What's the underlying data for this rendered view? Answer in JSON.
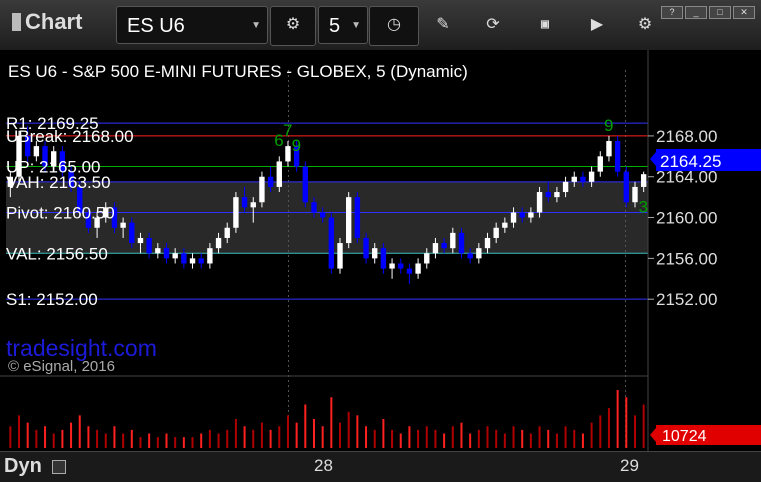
{
  "app": {
    "title": "Chart"
  },
  "toolbar": {
    "symbol": "ES U6",
    "interval": "5",
    "icons": [
      "settings-icon",
      "clock-icon",
      "pencil-icon",
      "refresh-icon",
      "quote-icon",
      "play-icon",
      "settings-wheel-icon"
    ]
  },
  "colors": {
    "background": "#000000",
    "up": "#ffffff",
    "down": "#0000ff",
    "resistance": "#ff0000",
    "value_high": "#00a000",
    "pivot_band": "#4a4a4a"
  },
  "chart_data": {
    "type": "candlestick",
    "title": "ES U6 - S&P 500 E-MINI FUTURES - GLOBEX, 5 (Dynamic)",
    "ylim": [
      2148.0,
      2172.5
    ],
    "yticks": [
      "2168.00",
      "2164.00",
      "2160.00",
      "2156.00",
      "2152.00"
    ],
    "ytick_values": [
      2168,
      2164,
      2160,
      2156,
      2152
    ],
    "xticks": [
      "28",
      "29"
    ],
    "last_price": "2164.25",
    "last_price_value": 2164.25,
    "last_volume": "10724",
    "levels": [
      {
        "label": "R1: 2169.25",
        "value": 2169.25,
        "color": "#3030ff"
      },
      {
        "label": "UBreak: 2168.00",
        "value": 2168.0,
        "color": "#ff2020"
      },
      {
        "label": "UP: 2165.00",
        "value": 2165.0,
        "color": "#00b000"
      },
      {
        "label": "VAH: 2163.50",
        "value": 2163.5,
        "color": "#3030ff"
      },
      {
        "label": "Pivot: 2160.50",
        "value": 2160.5,
        "color": "#3030ff"
      },
      {
        "label": "VAL: 2156.50",
        "value": 2156.5,
        "color": "#40c0c0"
      },
      {
        "label": "S1: 2152.00",
        "value": 2152.0,
        "color": "#3030ff"
      }
    ],
    "series": [
      {
        "type": "ohlc",
        "values": [
          [
            2163.0,
            2164.5,
            2162.0,
            2164.0
          ],
          [
            2164.0,
            2168.5,
            2163.5,
            2168.0
          ],
          [
            2168.0,
            2169.0,
            2165.5,
            2166.0
          ],
          [
            2166.0,
            2167.5,
            2165.5,
            2167.0
          ],
          [
            2167.0,
            2167.5,
            2164.5,
            2165.0
          ],
          [
            2165.0,
            2167.0,
            2164.5,
            2166.5
          ],
          [
            2166.5,
            2167.0,
            2164.0,
            2164.5
          ],
          [
            2164.5,
            2165.0,
            2162.5,
            2163.0
          ],
          [
            2163.0,
            2163.5,
            2160.0,
            2160.5
          ],
          [
            2160.5,
            2161.0,
            2158.5,
            2159.0
          ],
          [
            2159.0,
            2160.5,
            2158.0,
            2160.0
          ],
          [
            2160.0,
            2161.5,
            2159.5,
            2161.0
          ],
          [
            2161.0,
            2161.5,
            2158.5,
            2159.0
          ],
          [
            2159.0,
            2160.0,
            2158.0,
            2159.5
          ],
          [
            2159.5,
            2160.0,
            2157.0,
            2157.5
          ],
          [
            2157.5,
            2158.5,
            2156.5,
            2158.0
          ],
          [
            2158.0,
            2158.5,
            2156.0,
            2156.5
          ],
          [
            2156.5,
            2157.5,
            2156.0,
            2157.0
          ],
          [
            2157.0,
            2157.5,
            2155.5,
            2156.0
          ],
          [
            2156.0,
            2157.0,
            2155.5,
            2156.5
          ],
          [
            2156.5,
            2157.0,
            2155.0,
            2155.5
          ],
          [
            2155.5,
            2156.5,
            2155.0,
            2156.0
          ],
          [
            2156.0,
            2156.5,
            2155.0,
            2155.5
          ],
          [
            2155.5,
            2157.5,
            2155.0,
            2157.0
          ],
          [
            2157.0,
            2158.5,
            2156.5,
            2158.0
          ],
          [
            2158.0,
            2159.5,
            2157.5,
            2159.0
          ],
          [
            2159.0,
            2162.5,
            2158.5,
            2162.0
          ],
          [
            2162.0,
            2163.0,
            2160.5,
            2161.0
          ],
          [
            2161.0,
            2162.0,
            2159.5,
            2161.5
          ],
          [
            2161.5,
            2164.5,
            2161.0,
            2164.0
          ],
          [
            2164.0,
            2165.0,
            2162.5,
            2163.0
          ],
          [
            2163.0,
            2166.0,
            2162.5,
            2165.5
          ],
          [
            2165.5,
            2167.5,
            2165.0,
            2167.0
          ],
          [
            2167.0,
            2167.5,
            2164.5,
            2165.0
          ],
          [
            2165.0,
            2165.5,
            2161.0,
            2161.5
          ],
          [
            2161.5,
            2162.0,
            2160.0,
            2160.5
          ],
          [
            2160.5,
            2161.0,
            2159.5,
            2160.0
          ],
          [
            2160.0,
            2160.5,
            2154.5,
            2155.0
          ],
          [
            2155.0,
            2158.0,
            2154.5,
            2157.5
          ],
          [
            2157.5,
            2162.5,
            2157.0,
            2162.0
          ],
          [
            2162.0,
            2162.5,
            2157.5,
            2158.0
          ],
          [
            2158.0,
            2158.5,
            2155.5,
            2156.0
          ],
          [
            2156.0,
            2157.5,
            2155.5,
            2157.0
          ],
          [
            2157.0,
            2157.5,
            2154.5,
            2155.0
          ],
          [
            2155.0,
            2156.0,
            2154.0,
            2155.5
          ],
          [
            2155.5,
            2156.0,
            2154.5,
            2155.0
          ],
          [
            2155.0,
            2155.5,
            2153.5,
            2154.5
          ],
          [
            2154.5,
            2156.0,
            2154.0,
            2155.5
          ],
          [
            2155.5,
            2157.0,
            2155.0,
            2156.5
          ],
          [
            2156.5,
            2158.0,
            2156.0,
            2157.5
          ],
          [
            2157.5,
            2158.0,
            2156.5,
            2157.0
          ],
          [
            2157.0,
            2159.0,
            2156.5,
            2158.5
          ],
          [
            2158.5,
            2159.0,
            2156.0,
            2156.5
          ],
          [
            2156.5,
            2157.0,
            2155.5,
            2156.0
          ],
          [
            2156.0,
            2157.5,
            2155.5,
            2157.0
          ],
          [
            2157.0,
            2158.5,
            2156.5,
            2158.0
          ],
          [
            2158.0,
            2159.5,
            2157.5,
            2159.0
          ],
          [
            2159.0,
            2160.0,
            2158.5,
            2159.5
          ],
          [
            2159.5,
            2161.0,
            2159.0,
            2160.5
          ],
          [
            2160.5,
            2161.0,
            2159.5,
            2160.0
          ],
          [
            2160.0,
            2161.0,
            2159.5,
            2160.5
          ],
          [
            2160.5,
            2163.0,
            2160.0,
            2162.5
          ],
          [
            2162.5,
            2163.5,
            2161.5,
            2162.0
          ],
          [
            2162.0,
            2163.0,
            2161.5,
            2162.5
          ],
          [
            2162.5,
            2164.0,
            2162.0,
            2163.5
          ],
          [
            2163.5,
            2164.5,
            2163.0,
            2164.0
          ],
          [
            2164.0,
            2164.5,
            2163.0,
            2163.5
          ],
          [
            2163.5,
            2165.0,
            2163.0,
            2164.5
          ],
          [
            2164.5,
            2166.5,
            2164.0,
            2166.0
          ],
          [
            2166.0,
            2168.0,
            2165.5,
            2167.5
          ],
          [
            2167.5,
            2168.0,
            2164.0,
            2164.5
          ],
          [
            2164.5,
            2165.0,
            2161.0,
            2161.5
          ],
          [
            2161.5,
            2163.5,
            2161.0,
            2163.0
          ],
          [
            2163.0,
            2164.5,
            2162.5,
            2164.25
          ]
        ]
      },
      {
        "type": "volume",
        "values": [
          6,
          9,
          7,
          5,
          6,
          4,
          5,
          7,
          9,
          6,
          5,
          4,
          6,
          4,
          5,
          3,
          4,
          3,
          4,
          3,
          3,
          3,
          4,
          5,
          4,
          5,
          8,
          6,
          5,
          7,
          5,
          6,
          9,
          7,
          12,
          8,
          6,
          14,
          7,
          10,
          9,
          6,
          5,
          8,
          5,
          4,
          6,
          5,
          6,
          5,
          4,
          6,
          7,
          4,
          5,
          6,
          5,
          4,
          6,
          5,
          4,
          6,
          5,
          4,
          6,
          5,
          4,
          7,
          9,
          11,
          16,
          14,
          9,
          12
        ]
      }
    ],
    "td_counts": [
      {
        "label": "7",
        "x_index": 32,
        "price": 2168.0
      },
      {
        "label": "6",
        "x_index": 31,
        "price": 2167.0
      },
      {
        "label": "9",
        "x_index": 33,
        "price": 2166.5
      },
      {
        "label": "9",
        "x_index": 69,
        "price": 2168.5
      },
      {
        "label": "3",
        "x_index": 73,
        "price": 2160.5
      }
    ]
  },
  "watermark": {
    "brand": "tradesight.com",
    "copyright": "© eSignal, 2016"
  },
  "statusbar": {
    "mode": "Dyn"
  }
}
